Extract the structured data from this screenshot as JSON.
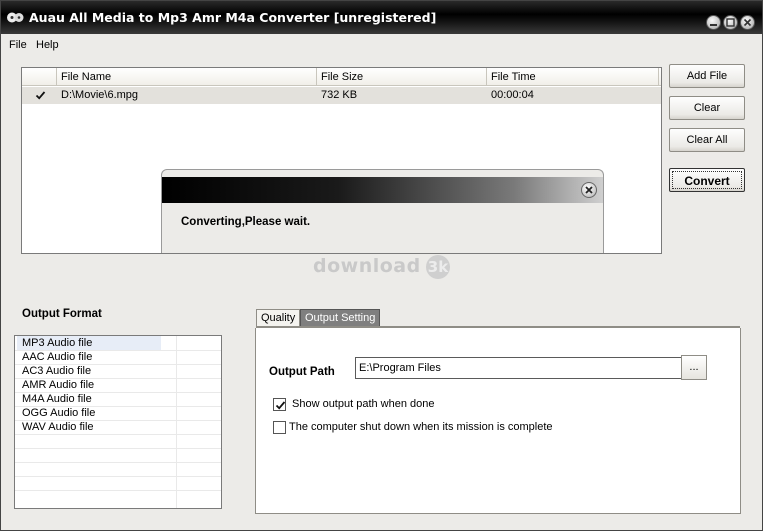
{
  "window": {
    "title": "Auau All Media to Mp3 Amr M4a Converter  [unregistered]"
  },
  "menu": {
    "file": "File",
    "help": "Help"
  },
  "file_list": {
    "columns": [
      "File Name",
      "File Size",
      "File Time"
    ],
    "rows": [
      {
        "checked": true,
        "name": "D:\\Movie\\6.mpg",
        "size": "732 KB",
        "time": "00:00:04"
      }
    ]
  },
  "buttons": {
    "add_file": "Add File",
    "clear": "Clear",
    "clear_all": "Clear All",
    "convert": "Convert"
  },
  "dialog": {
    "message": "Converting,Please wait."
  },
  "watermark": {
    "text": "download",
    "badge": "3k"
  },
  "output_format": {
    "label": "Output Format",
    "items": [
      "MP3 Audio file",
      "AAC Audio file",
      "AC3 Audio file",
      "AMR Audio file",
      "M4A Audio file",
      "OGG Audio file",
      "WAV Audio file"
    ],
    "selected": "MP3 Audio file"
  },
  "tabs": {
    "quality": "Quality",
    "output_setting": "Output Setting",
    "active": "Output Setting"
  },
  "output_setting": {
    "path_label": "Output Path",
    "path_value": "E:\\Program Files",
    "browse_label": "...",
    "show_path_label": "Show output path when done",
    "show_path_checked": true,
    "shutdown_label": "The computer shut down when its mission is complete",
    "shutdown_checked": false
  }
}
